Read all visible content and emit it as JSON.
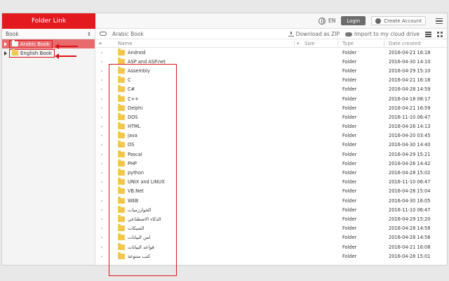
{
  "app": {
    "title": "Folder Link"
  },
  "topbar": {
    "language": "EN",
    "login_label": "Login",
    "create_account_label": "Create Account"
  },
  "sidebar": {
    "select_label": "Book",
    "items": [
      {
        "label": "Arabic Book",
        "active": true
      },
      {
        "label": "English Book",
        "active": false
      }
    ]
  },
  "main": {
    "path": "Arabic Book",
    "download_label": "Download as ZIP",
    "import_label": "Import to my cloud drive",
    "columns": {
      "star": "★",
      "name": "Name",
      "size": "Size",
      "type": "Type",
      "date": "Date created"
    },
    "rows": [
      {
        "name": "Android",
        "type": "Folder",
        "date": "2016-04-21 16:18"
      },
      {
        "name": "ASP and ASP.net",
        "type": "Folder",
        "date": "2016-04-30 14:10"
      },
      {
        "name": "Assembly",
        "type": "Folder",
        "date": "2016-04-29 15:10"
      },
      {
        "name": "C",
        "type": "Folder",
        "date": "2016-04-21 16:18"
      },
      {
        "name": "C#",
        "type": "Folder",
        "date": "2016-04-28 14:59"
      },
      {
        "name": "C++",
        "type": "Folder",
        "date": "2016-04-18 08:17"
      },
      {
        "name": "Delphi",
        "type": "Folder",
        "date": "2016-04-21 16:59"
      },
      {
        "name": "DOS",
        "type": "Folder",
        "date": "2016-11-10 06:47"
      },
      {
        "name": "HTML",
        "type": "Folder",
        "date": "2016-04-26 14:13"
      },
      {
        "name": "java",
        "type": "Folder",
        "date": "2016-04-20 03:45"
      },
      {
        "name": "OS",
        "type": "Folder",
        "date": "2016-04-30 14:40"
      },
      {
        "name": "Pascal",
        "type": "Folder",
        "date": "2016-04-29 15:21"
      },
      {
        "name": "PHP",
        "type": "Folder",
        "date": "2016-04-26 14:42"
      },
      {
        "name": "python",
        "type": "Folder",
        "date": "2016-04-28 15:02"
      },
      {
        "name": "UNIX and LINUX",
        "type": "Folder",
        "date": "2016-11-10 06:47"
      },
      {
        "name": "VB.Net",
        "type": "Folder",
        "date": "2016-04-28 15:04"
      },
      {
        "name": "WEB",
        "type": "Folder",
        "date": "2016-04-30 16:05"
      },
      {
        "name": "الخوارزميات",
        "type": "Folder",
        "date": "2016-11-10 06:47"
      },
      {
        "name": "الذكاء الاصطناعي",
        "type": "Folder",
        "date": "2016-04-29 15:20"
      },
      {
        "name": "الشبكات",
        "type": "Folder",
        "date": "2016-04-28 14:58"
      },
      {
        "name": "امن البيانات",
        "type": "Folder",
        "date": "2016-04-28 14:58"
      },
      {
        "name": "قواعد البيانات",
        "type": "Folder",
        "date": "2016-04-21 16:08"
      },
      {
        "name": "كتب متنوعة",
        "type": "Folder",
        "date": "2016-04-28 15:01"
      }
    ]
  },
  "colors": {
    "brand": "#e2191f",
    "active_item": "#e96a6d",
    "folder": "#f3c74f",
    "annotation": "#d8151b"
  }
}
